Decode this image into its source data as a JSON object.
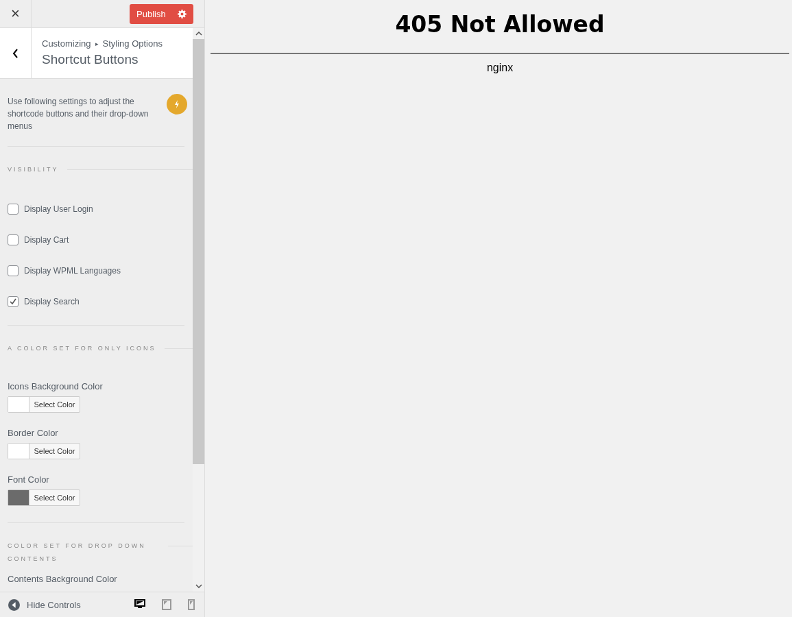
{
  "topbar": {
    "close": "×",
    "publish": "Publish"
  },
  "header": {
    "breadcrumb": [
      "Customizing",
      "Styling Options"
    ],
    "breadcrumb_separator": "▸",
    "title": "Shortcut Buttons"
  },
  "description": "Use following settings to adjust the shortcode buttons and their drop-down menus",
  "sections": [
    {
      "heading": "VISIBILITY",
      "controls": [
        {
          "kind": "checkbox",
          "label": "Display User Login",
          "checked": false
        },
        {
          "kind": "checkbox",
          "label": "Display Cart",
          "checked": false
        },
        {
          "kind": "checkbox",
          "label": "Display WPML Languages",
          "checked": false
        },
        {
          "kind": "checkbox",
          "label": "Display Search",
          "checked": true
        }
      ]
    },
    {
      "heading": "A COLOR SET FOR ONLY ICONS",
      "controls": [
        {
          "kind": "color",
          "label": "Icons Background Color",
          "button": "Select Color",
          "color": "#ffffff"
        },
        {
          "kind": "color",
          "label": "Border Color",
          "button": "Select Color",
          "color": "#ffffff"
        },
        {
          "kind": "color",
          "label": "Font Color",
          "button": "Select Color",
          "color": "#6b6b6b"
        }
      ]
    },
    {
      "heading": "COLOR SET FOR DROP DOWN CONTENTS",
      "controls": [
        {
          "kind": "color_label",
          "label": "Contents Background Color"
        }
      ]
    }
  ],
  "footer": {
    "hide_controls": "Hide Controls",
    "devices": [
      {
        "kind": "desktop",
        "selected": true
      },
      {
        "kind": "tablet",
        "selected": false
      },
      {
        "kind": "mobile",
        "selected": false
      }
    ]
  },
  "preview": {
    "heading": "405 Not Allowed",
    "server": "nginx"
  }
}
